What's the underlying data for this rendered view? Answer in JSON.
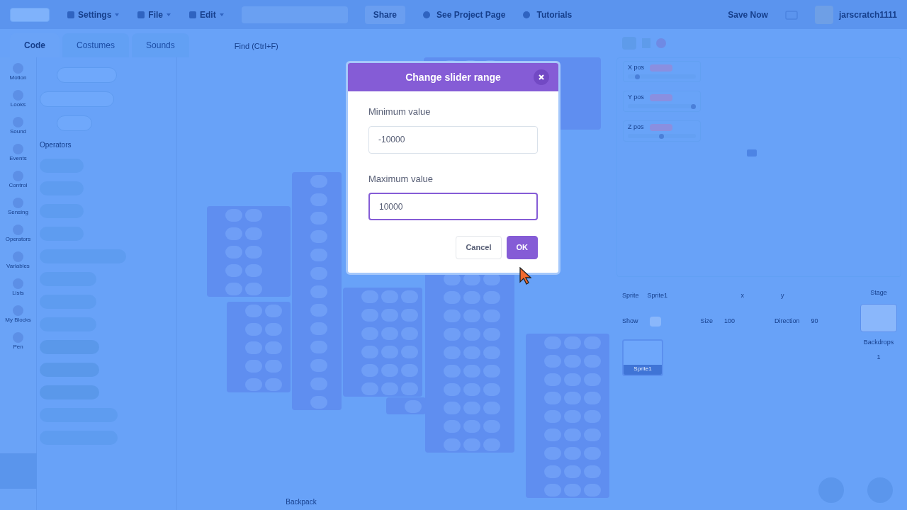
{
  "menu_bar": {
    "items": [
      {
        "label": "Settings"
      },
      {
        "label": "File"
      },
      {
        "label": "Edit"
      }
    ],
    "share": "Share",
    "links": [
      {
        "label": "See Project Page"
      },
      {
        "label": "Tutorials"
      }
    ],
    "save": "Save Now",
    "username": "jarscratch1111"
  },
  "editor_tabs": [
    {
      "label": "Code",
      "selected": true
    },
    {
      "label": "Costumes",
      "selected": false
    },
    {
      "label": "Sounds",
      "selected": false
    }
  ],
  "find": {
    "placeholder": "Find (Ctrl+F)"
  },
  "categories": [
    {
      "label": "Motion"
    },
    {
      "label": "Looks"
    },
    {
      "label": "Sound"
    },
    {
      "label": "Events"
    },
    {
      "label": "Control"
    },
    {
      "label": "Sensing"
    },
    {
      "label": "Operators"
    },
    {
      "label": "Variables"
    },
    {
      "label": "Lists"
    },
    {
      "label": "My Blocks"
    },
    {
      "label": "Pen"
    }
  ],
  "palette": {
    "heading": "Operators"
  },
  "monitors": [
    {
      "label": "X pos",
      "level": 0.15
    },
    {
      "label": "Y pos",
      "level": 0.97
    },
    {
      "label": "Z pos",
      "level": 0.5
    }
  ],
  "sprite_info": {
    "sprite_label": "Sprite",
    "sprite_name": "Sprite1",
    "x_label": "x",
    "y_label": "y",
    "show_label": "Show",
    "size_label": "Size",
    "size": "100",
    "direction_label": "Direction",
    "direction": "90"
  },
  "sprites": [
    {
      "name": "Sprite1",
      "selected": true
    }
  ],
  "stage_panel": {
    "title": "Stage",
    "backdrops_label": "Backdrops",
    "backdrops": "1"
  },
  "backpack": "Backpack",
  "dialog": {
    "title": "Change slider range",
    "fields": [
      {
        "label": "Minimum value",
        "value": "-10000",
        "focused": false
      },
      {
        "label": "Maximum value",
        "value": "10000",
        "focused": true
      }
    ],
    "buttons": [
      {
        "label": "Cancel",
        "kind": "secondary"
      },
      {
        "label": "OK",
        "kind": "primary"
      }
    ]
  }
}
